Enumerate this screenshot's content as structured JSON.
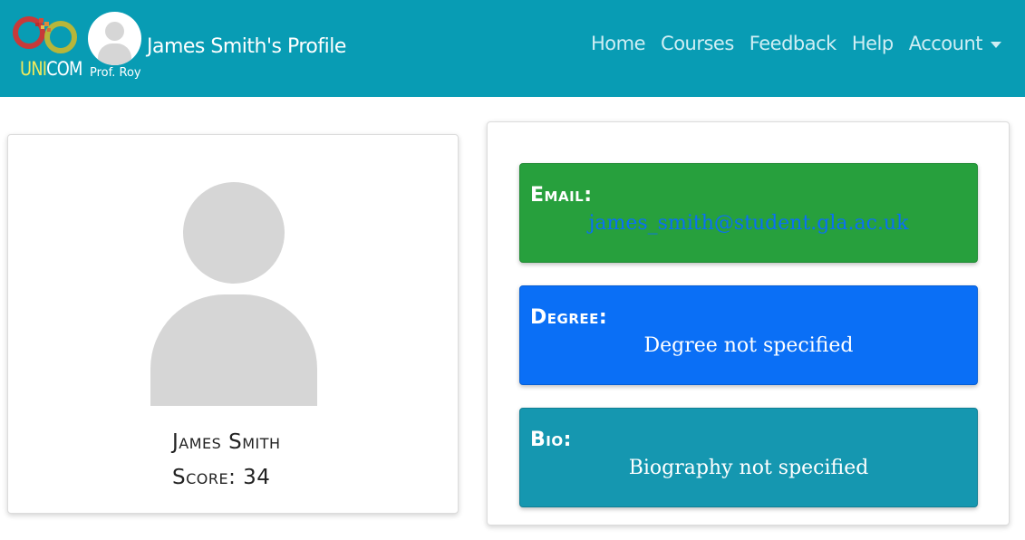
{
  "brand": {
    "logo_prefix": "UNI",
    "logo_suffix": "COM",
    "logo_prefix_color": "#f2ea5b",
    "logo_suffix_color": "#ffffff"
  },
  "header": {
    "teacher_name": "Prof. Roy",
    "profile_title": "James Smith's Profile",
    "background_color": "#089cb4"
  },
  "nav": {
    "items": [
      {
        "label": "Home"
      },
      {
        "label": "Courses"
      },
      {
        "label": "Feedback"
      },
      {
        "label": "Help"
      },
      {
        "label": "Account",
        "icon": "caret-down-icon"
      }
    ]
  },
  "profile": {
    "name": "James Smith",
    "score_label": "Score:",
    "score": "34",
    "avatar_icon": "user-placeholder-icon"
  },
  "details": {
    "email": {
      "label": "Email:",
      "value": "james_smith@student.gla.ac.uk",
      "color": "#27a03d"
    },
    "degree": {
      "label": "Degree:",
      "value": "Degree not specified",
      "color": "#0a6ff6"
    },
    "bio": {
      "label": "Bio:",
      "value": "Biography not specified",
      "color": "#1597b0"
    }
  }
}
